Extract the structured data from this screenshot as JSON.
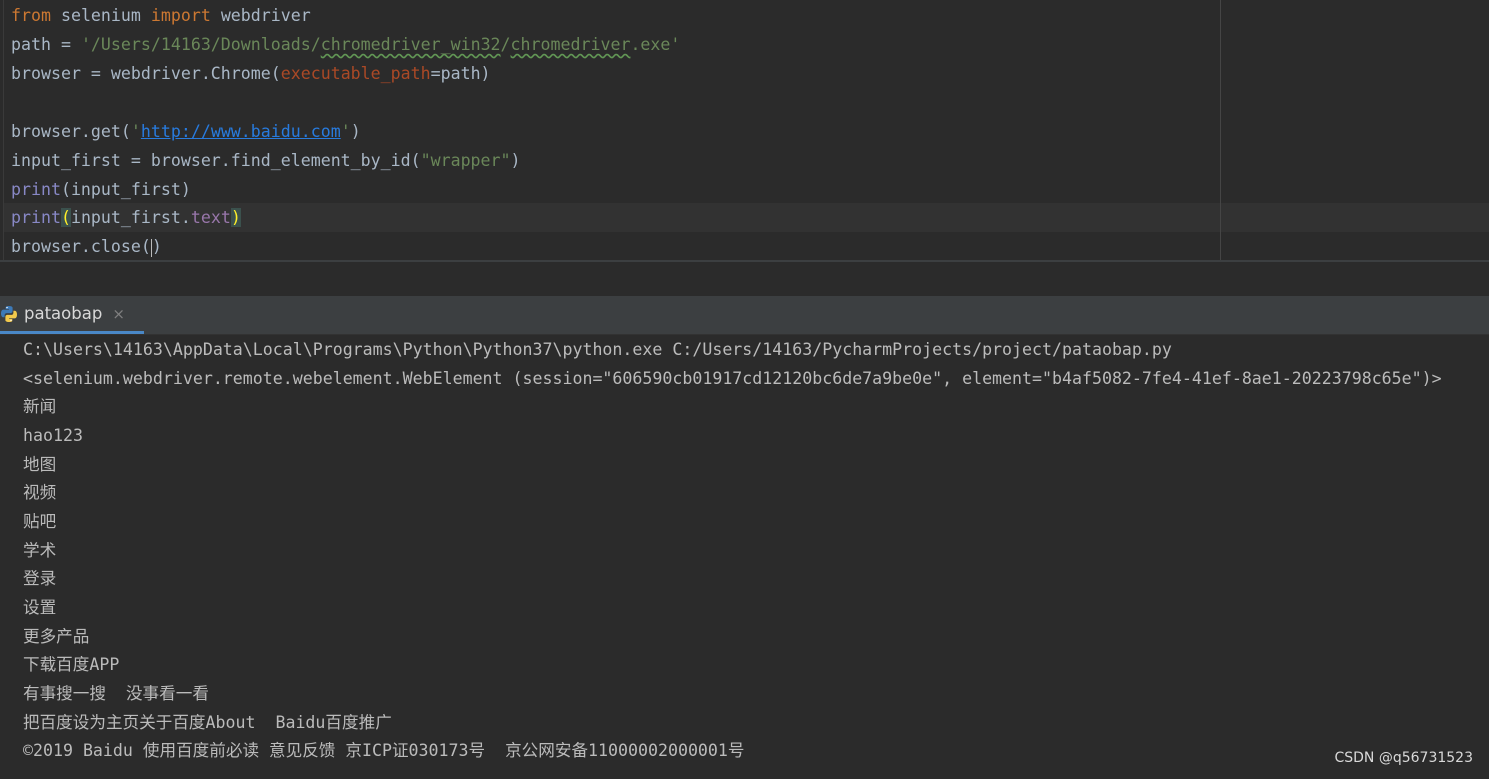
{
  "editor": {
    "lines": [
      {
        "t1": "from",
        "t2": " selenium ",
        "t3": "import",
        "t4": " webdriver"
      },
      {
        "t1": "path = ",
        "t2": "'/Users/14163/Downloads/",
        "t3": "chromedriver_win32",
        "t4": "/",
        "t5": "chromedriver",
        "t6": ".exe'"
      },
      {
        "t1": "browser = webdriver.Chrome(",
        "t2": "executable_path",
        "t3": "=path)"
      },
      {
        "t1": ""
      },
      {
        "t1": "browser.get(",
        "t2": "'",
        "t3": "http://www.baidu.com",
        "t4": "'",
        "t5": ")"
      },
      {
        "t1": "input_first = browser.find_element_by_id(",
        "t2": "\"wrapper\"",
        "t3": ")"
      },
      {
        "t1": "print",
        "t2": "(input_first)"
      },
      {
        "t1": "print",
        "t2": "(",
        "t3": "input_first.",
        "t4": "text",
        "t5": ")"
      },
      {
        "t1": "browser.close(",
        "t2": ")"
      }
    ]
  },
  "run_panel": {
    "tab_label": "pataobap",
    "close_glyph": "×"
  },
  "console": {
    "lines": [
      "C:\\Users\\14163\\AppData\\Local\\Programs\\Python\\Python37\\python.exe C:/Users/14163/PycharmProjects/project/pataobap.py",
      "<selenium.webdriver.remote.webelement.WebElement (session=\"606590cb01917cd12120bc6de7a9be0e\", element=\"b4af5082-7fe4-41ef-8ae1-20223798c65e\")>",
      "新闻",
      "hao123",
      "地图",
      "视频",
      "贴吧",
      "学术",
      "登录",
      "设置",
      "更多产品",
      "下载百度APP",
      "有事搜一搜  没事看一看",
      "把百度设为主页关于百度About  Baidu百度推广",
      "©2019 Baidu 使用百度前必读 意见反馈 京ICP证030173号  京公网安备11000002000001号"
    ]
  },
  "watermark": "CSDN @q56731523",
  "colors": {
    "background": "#2b2b2b",
    "keyword": "#cc7832",
    "string": "#6a8759",
    "parameter": "#aa4926",
    "field": "#9876aa",
    "builtin": "#8888c6",
    "url": "#287bde",
    "tab_underline": "#4a88c7"
  },
  "icons": {
    "run_tab": "python-icon"
  }
}
